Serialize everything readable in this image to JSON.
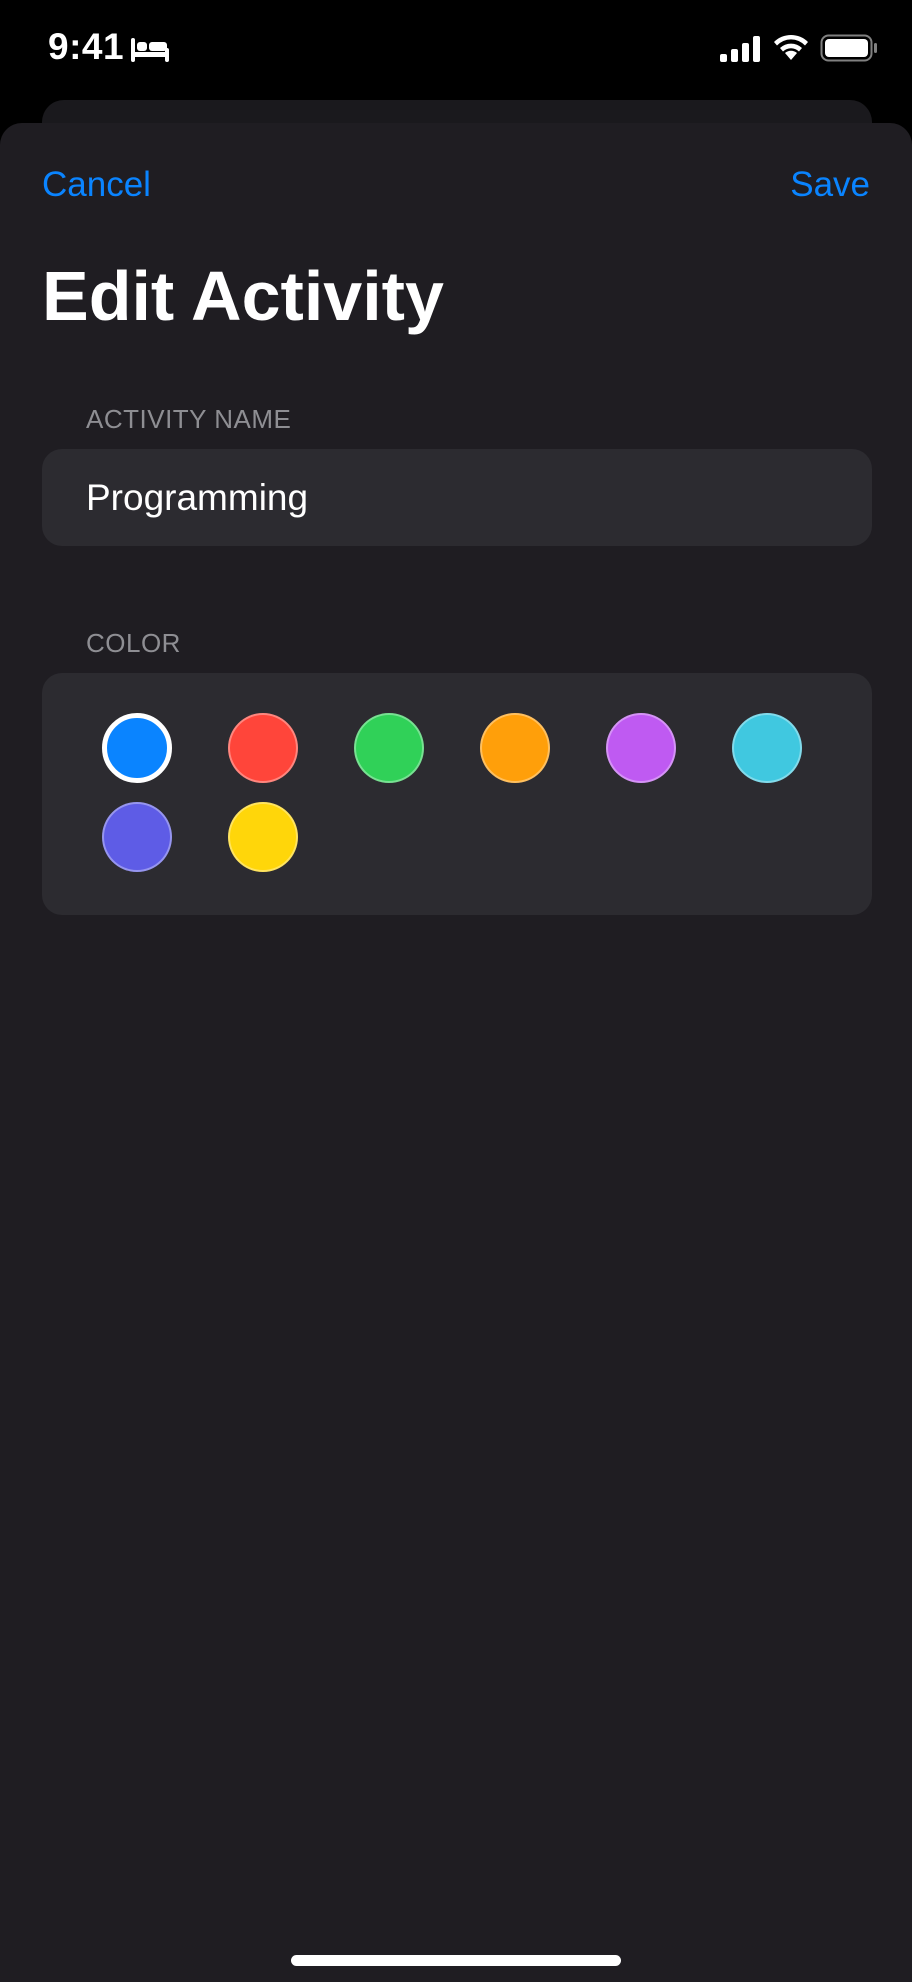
{
  "status_bar": {
    "time": "9:41"
  },
  "nav": {
    "cancel_label": "Cancel",
    "save_label": "Save"
  },
  "title": "Edit Activity",
  "activity_name": {
    "label": "ACTIVITY NAME",
    "value": "Programming"
  },
  "color": {
    "label": "COLOR",
    "selected_index": 0,
    "options": [
      {
        "name": "blue",
        "hex": "#0a84ff"
      },
      {
        "name": "red",
        "hex": "#ff453a"
      },
      {
        "name": "green",
        "hex": "#30d158"
      },
      {
        "name": "orange",
        "hex": "#ff9f0a"
      },
      {
        "name": "purple",
        "hex": "#bf5af2"
      },
      {
        "name": "teal",
        "hex": "#40c8e0"
      },
      {
        "name": "indigo",
        "hex": "#5e5ce6"
      },
      {
        "name": "yellow",
        "hex": "#ffd60a"
      }
    ]
  },
  "theme": {
    "accent": "#0a84ff",
    "sheet_background": "#1f1d22",
    "card_background": "#2c2b30",
    "secondary_text": "#8e8e93"
  },
  "icons": [
    "sleep-bed-icon",
    "cellular-signal-icon",
    "wifi-icon",
    "battery-icon"
  ]
}
